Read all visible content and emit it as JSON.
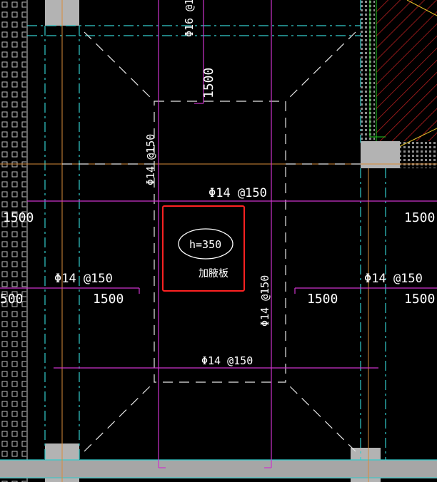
{
  "drawing": {
    "labels": {
      "rebar_top_vertical": "Φ16 @1",
      "dim_top_1500": "1500",
      "rebar_left_vertical": "Φ14 @150",
      "rebar_center_horizontal": "Φ14 @150",
      "dim_left_1500": "1500",
      "dim_right_1500": "1500",
      "rebar_left_lower": "Φ14 @150",
      "rebar_right_lower": "Φ14 @150",
      "dim_left_500": "500",
      "dim_left_lower_1500": "1500",
      "dim_right_lower_1500_a": "1500",
      "dim_right_lower_1500_b": "1500",
      "rebar_right_vertical": "Φ14 @150",
      "rebar_bottom_horizontal": "Φ14 @150",
      "slab_thickness": "h=350",
      "slab_name": "加腋板"
    },
    "colors": {
      "background": "#000000",
      "magenta_line": "#cc33cc",
      "cyan_dash": "#33cccc",
      "white_dash": "#e6e6e6",
      "orange_line": "#d98c3a",
      "gray_column": "#b3b3b3",
      "highlight_box": "#ff2222",
      "hatch_red": "#cc2222",
      "green_outline": "#22cc22"
    }
  }
}
